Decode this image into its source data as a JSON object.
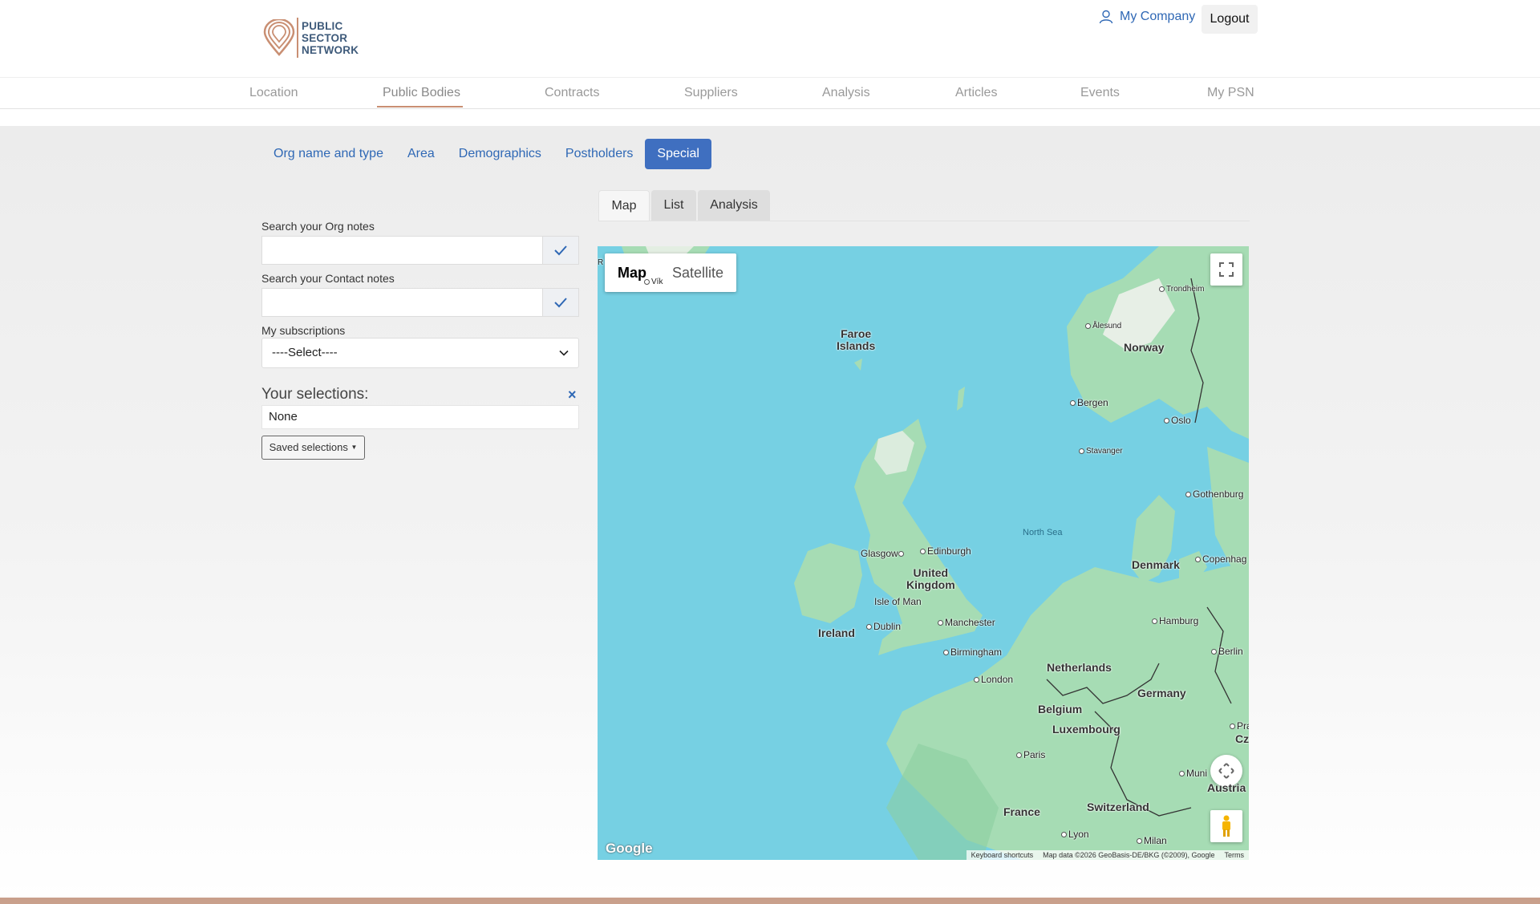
{
  "header": {
    "logo_lines": [
      "PUBLIC",
      "SECTOR",
      "NETWORK"
    ],
    "user_link": "My Company",
    "logout_label": "Logout"
  },
  "nav": {
    "items": [
      "Location",
      "Public Bodies",
      "Contracts",
      "Suppliers",
      "Analysis",
      "Articles",
      "Events",
      "My PSN"
    ],
    "active": "Public Bodies"
  },
  "subtabs": {
    "items": [
      "Org name and type",
      "Area",
      "Demographics",
      "Postholders",
      "Special"
    ],
    "active": "Special"
  },
  "form": {
    "org_notes_label": "Search your Org notes",
    "org_notes_value": "",
    "contact_notes_label": "Search your Contact notes",
    "contact_notes_value": "",
    "subscriptions_label": "My subscriptions",
    "subscriptions_value": "----Select----",
    "selections_title": "Your selections:",
    "selections_clear": "×",
    "selections_value": "None",
    "saved_selections_label": "Saved selections"
  },
  "view_tabs": {
    "items": [
      "Map",
      "List",
      "Analysis"
    ],
    "active": "Map"
  },
  "map": {
    "type_map": "Map",
    "type_satellite": "Satellite",
    "google_logo": "Google",
    "attribution": {
      "shortcuts": "Keyboard shortcuts",
      "data": "Map data ©2026 GeoBasis-DE/BKG (©2009), Google",
      "terms": "Terms"
    },
    "labels": {
      "faroe": "Faroe\nIslands",
      "norway": "Norway",
      "uk": "United\nKingdom",
      "ireland": "Ireland",
      "denmark": "Denmark",
      "netherlands": "Netherlands",
      "belgium": "Belgium",
      "luxembourg": "Luxembourg",
      "germany": "Germany",
      "france": "France",
      "switzerland": "Switzerland",
      "austria": "Austria",
      "czech": "Czec",
      "north_sea": "North Sea",
      "isle_of_man": "Isle of Man",
      "vik": "Vík",
      "trondheim": "Trondheim",
      "alesund": "Ålesund",
      "bergen": "Bergen",
      "oslo": "Oslo",
      "stavanger": "Stavanger",
      "gothenburg": "Gothenburg",
      "copenhagen": "Copenhag",
      "glasgow": "Glasgow",
      "edinburgh": "Edinburgh",
      "dublin": "Dublin",
      "manchester": "Manchester",
      "birmingham": "Birmingham",
      "london": "London",
      "hamburg": "Hamburg",
      "berlin": "Berlin",
      "paris": "Paris",
      "lyon": "Lyon",
      "milan": "Milan",
      "munich": "Muni",
      "prague": "Pra"
    },
    "colors": {
      "sea": "#76d0e3",
      "land": "#a6dcb4",
      "land_dark": "#8ccfa0",
      "snow": "#f2f2ee"
    }
  }
}
